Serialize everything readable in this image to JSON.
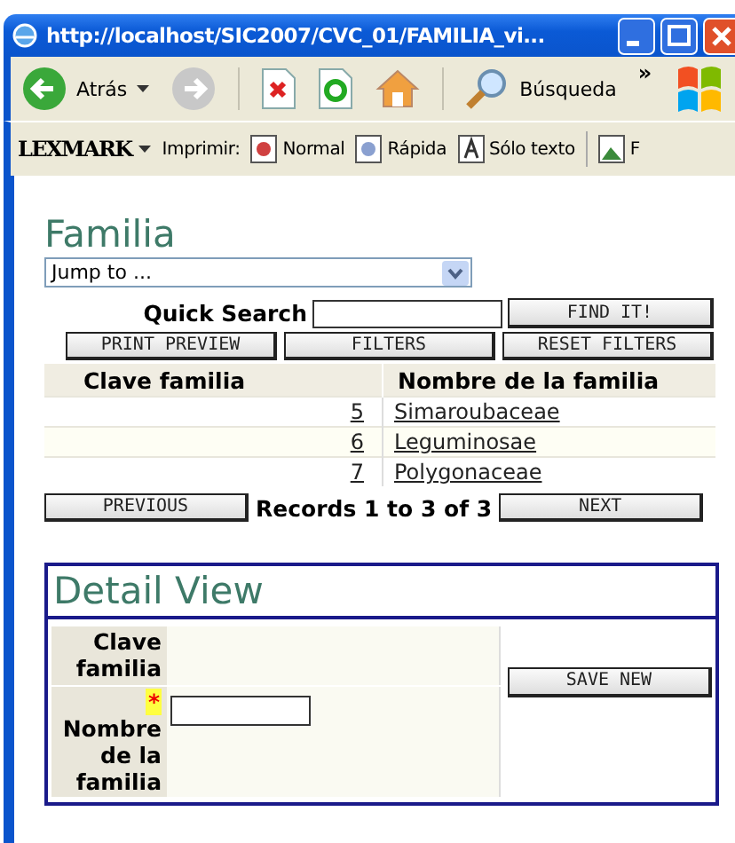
{
  "window": {
    "title": "http://localhost/SIC2007/CVC_01/FAMILIA_vi..."
  },
  "toolbar": {
    "items": [
      {
        "kind": "back",
        "label": "Atrás"
      },
      {
        "kind": "forward"
      },
      {
        "kind": "stop"
      },
      {
        "kind": "refresh"
      },
      {
        "kind": "home"
      },
      {
        "kind": "search",
        "label": "Búsqueda"
      }
    ],
    "overflow": "»"
  },
  "lexmark_bar": {
    "brand": "LEXMARK",
    "print_label": "Imprimir:",
    "items": [
      {
        "label": "Normal"
      },
      {
        "label": "Rápida"
      },
      {
        "label": "Sólo texto"
      },
      {
        "label": "F"
      }
    ]
  },
  "list": {
    "title": "Familia",
    "jump_to": "Jump to ...",
    "quick_search": {
      "label": "Quick Search",
      "button": "FIND IT!"
    },
    "buttons": [
      "PRINT PREVIEW",
      "FILTERS",
      "RESET FILTERS"
    ],
    "table": {
      "columns": [
        "Clave familia",
        "Nombre de la familia"
      ],
      "rows": [
        [
          "5",
          "Simaroubaceae"
        ],
        [
          "6",
          "Leguminosae"
        ],
        [
          "7",
          "Polygonaceae"
        ]
      ]
    },
    "pager": {
      "previous": "PREVIOUS",
      "status": "Records 1 to 3 of 3",
      "next": "NEXT"
    }
  },
  "detail": {
    "title": "Detail View",
    "required_mark": "*",
    "fields": [
      {
        "label": "Clave familia",
        "kind": "readonly",
        "required": false
      },
      {
        "label": "Nombre de la familia",
        "kind": "input",
        "required": true
      }
    ],
    "button": "SAVE NEW"
  }
}
